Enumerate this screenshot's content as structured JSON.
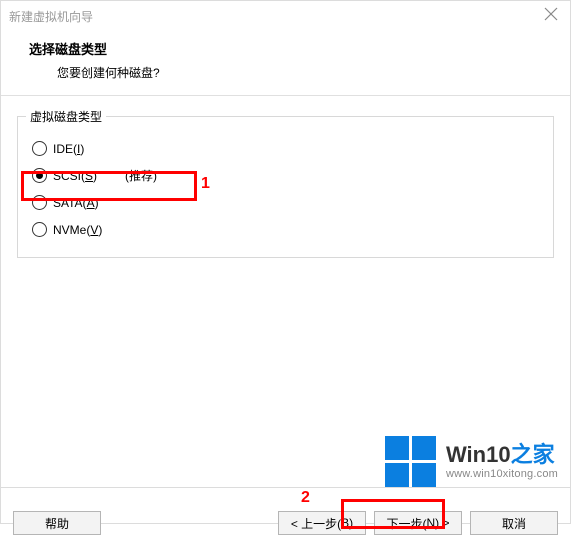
{
  "window": {
    "title": "新建虚拟机向导"
  },
  "header": {
    "title": "选择磁盘类型",
    "subtitle": "您要创建何种磁盘?"
  },
  "group": {
    "legend": "虚拟磁盘类型"
  },
  "options": {
    "ide": {
      "label_pre": "IDE(",
      "hotkey": "I",
      "label_post": ")"
    },
    "scsi": {
      "label_pre": "SCSI(",
      "hotkey": "S",
      "label_post": ")",
      "recommend": "(推荐)"
    },
    "sata": {
      "label_pre": "SATA(",
      "hotkey": "A",
      "label_post": ")"
    },
    "nvme": {
      "label_pre": "NVMe(",
      "hotkey": "V",
      "label_post": ")"
    }
  },
  "buttons": {
    "help": "帮助",
    "back_pre": "< 上一步(",
    "back_key": "B",
    "back_post": ")",
    "next_pre": "下一步(",
    "next_key": "N",
    "next_post": ") >",
    "cancel": "取消"
  },
  "annotations": {
    "a1": "1",
    "a2": "2"
  },
  "watermark": {
    "brand_main": "Win10",
    "brand_suffix": "之家",
    "url": "www.win10xitong.com"
  }
}
